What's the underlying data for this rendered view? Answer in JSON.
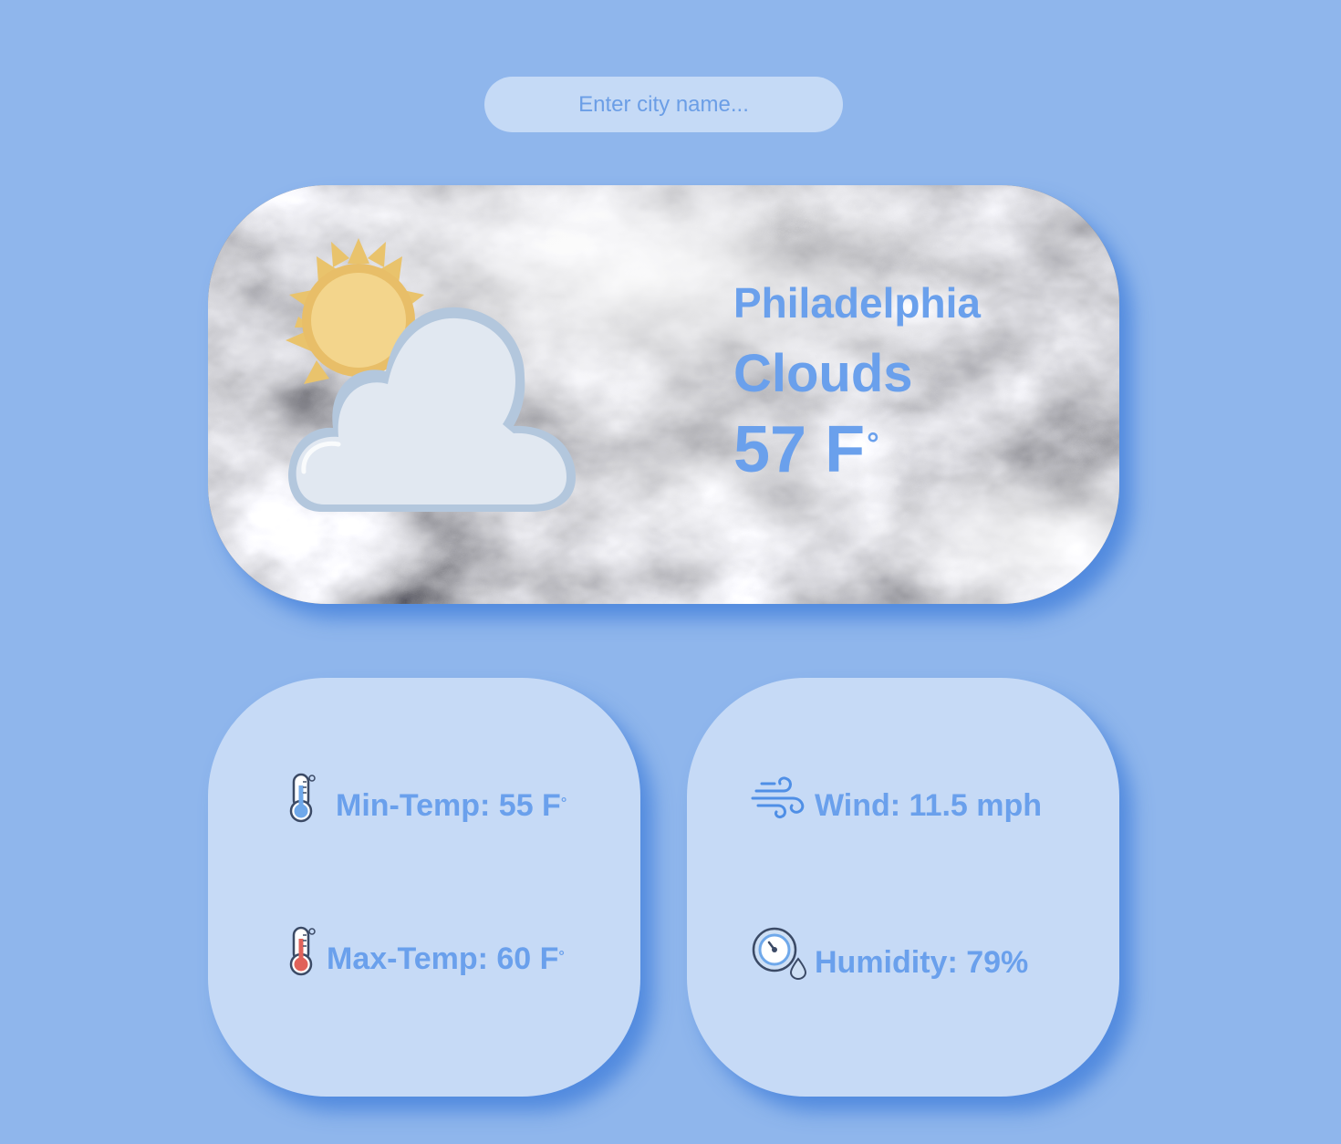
{
  "search": {
    "placeholder": "Enter city name..."
  },
  "current": {
    "city": "Philadelphia",
    "condition": "Clouds",
    "temperature": "57 F",
    "degree_symbol": "°",
    "icon": "sun-behind-cloud-icon",
    "background": "storm-clouds-photo"
  },
  "temps": {
    "min_label": "Min-Temp: 55 F",
    "max_label": "Max-Temp: 60 F",
    "degree_symbol": "°",
    "min_icon": "thermometer-cold-icon",
    "max_icon": "thermometer-hot-icon"
  },
  "conditions": {
    "wind_label": "Wind: 11.5 mph",
    "humidity_label": "Humidity: 79%",
    "wind_icon": "wind-icon",
    "humidity_icon": "humidity-gauge-icon"
  },
  "colors": {
    "page_background": "#8fb6ec",
    "card_background": "#c6daf6",
    "accent_text": "#6aa0ec",
    "shadow": "#4682dc"
  }
}
